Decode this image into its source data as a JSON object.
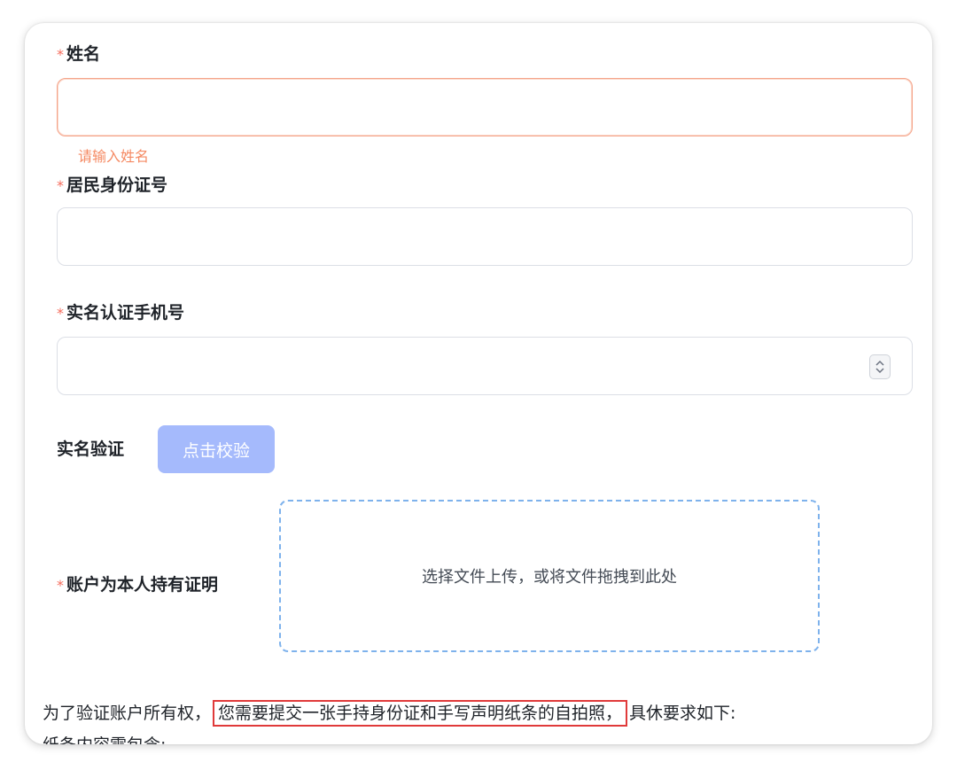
{
  "form": {
    "name": {
      "label": "姓名",
      "required_mark": "*",
      "value": "",
      "error": "请输入姓名"
    },
    "id_number": {
      "label": "居民身份证号",
      "required_mark": "*",
      "value": ""
    },
    "phone": {
      "label": "实名认证手机号",
      "required_mark": "*",
      "value": ""
    },
    "verification": {
      "label": "实名验证",
      "button_label": "点击校验"
    },
    "ownership_proof": {
      "label": "账户为本人持有证明",
      "required_mark": "*",
      "upload_text": "选择文件上传，或将文件拖拽到此处"
    }
  },
  "notice": {
    "prefix": "为了验证账户所有权，",
    "highlight": "您需要提交一张手持身份证和手写声明纸条的自拍照，",
    "suffix": "具休要求如下:",
    "next_line": "纸条内容需包含:"
  },
  "colors": {
    "required_star": "#f56c5c",
    "error_text": "#f58a63",
    "error_border": "#f5a48a",
    "button_bg": "#a5bafc",
    "upload_border": "#7eb2ec",
    "highlight_border": "#e03a3a"
  }
}
